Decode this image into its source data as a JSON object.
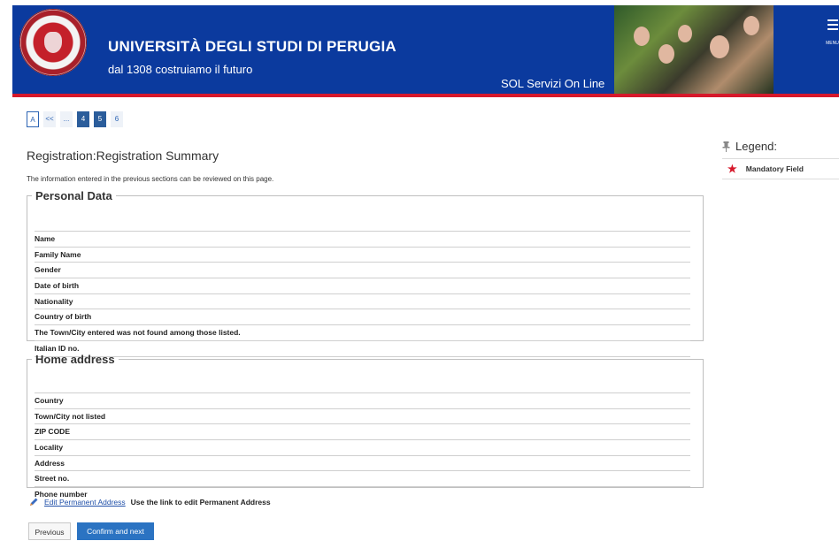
{
  "header": {
    "university": "UNIVERSITÀ DEGLI STUDI DI PERUGIA",
    "tagline": "dal 1308 costruiamo il futuro",
    "service": "SOL Servizi On Line",
    "menu_label": "MENU",
    "colors": {
      "header_blue": "#0b3a9e",
      "accent_red": "#d6182b"
    }
  },
  "steps": [
    "A",
    "<<",
    "...",
    "4",
    "5",
    "6"
  ],
  "page": {
    "title": "Registration:Registration Summary",
    "intro": "The information entered in the previous sections can be reviewed on this page."
  },
  "personal": {
    "legend": "Personal Data",
    "rows": [
      "Name",
      "Family Name",
      "Gender",
      "Date of birth",
      "Nationality",
      "Country of birth",
      "The Town/City entered was not found among those listed.",
      "Italian ID no."
    ]
  },
  "home": {
    "legend": "Home address",
    "rows": [
      "Country",
      "Town/City not listed",
      "ZIP CODE",
      "Locality",
      "Address",
      "Street no.",
      "Phone number"
    ]
  },
  "edit": {
    "link": "Edit Permanent Address",
    "note": "Use the link to edit Permanent Address",
    "icon": "pencil-icon"
  },
  "buttons": {
    "previous": "Previous",
    "confirm": "Confirm and next"
  },
  "legend_panel": {
    "title": "Legend:",
    "mandatory": "Mandatory Field",
    "icon": "pin-icon"
  }
}
